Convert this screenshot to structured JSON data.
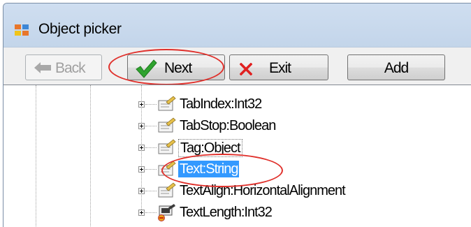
{
  "window": {
    "title": "Object picker",
    "icon": "application-form-icon"
  },
  "toolbar": {
    "back_label": "Back",
    "back_icon": "back-arrow-icon",
    "next_label": "Next",
    "next_icon": "green-checkmark-icon",
    "exit_label": "Exit",
    "exit_icon": "red-x-icon",
    "add_label": "Add"
  },
  "tree": {
    "items": [
      {
        "label": "TabIndex:Int32",
        "icon": "property-icon"
      },
      {
        "label": "TabStop:Boolean",
        "icon": "property-icon"
      },
      {
        "label": "Tag:Object",
        "icon": "property-icon"
      },
      {
        "label": "Text:String",
        "icon": "property-icon",
        "selected": true
      },
      {
        "label": "TextAlign:HorizontalAlignment",
        "icon": "property-icon"
      },
      {
        "label": "TextLength:Int32",
        "icon": "readonly-property-icon"
      }
    ]
  },
  "colors": {
    "selection": "#3399ff",
    "annotation": "#e0302b",
    "check_green": "#2fa32f"
  }
}
